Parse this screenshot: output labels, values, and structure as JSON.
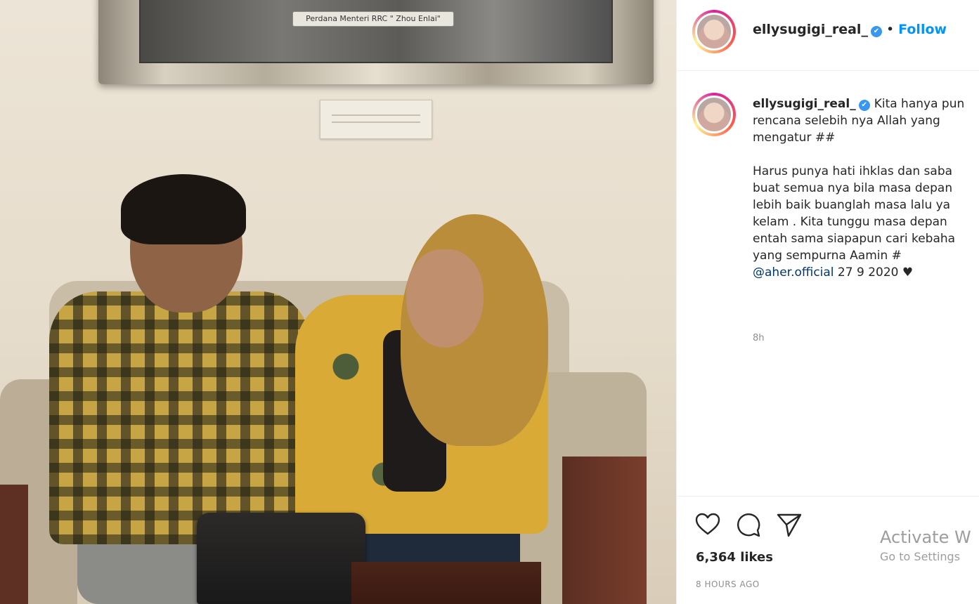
{
  "photo": {
    "frame_caption": "Perdana Menteri RRC \" Zhou Enlai\""
  },
  "header": {
    "username": "ellysugigi_real_",
    "verified_glyph": "✔",
    "separator": "•",
    "follow_label": "Follow"
  },
  "caption": {
    "username": "ellysugigi_real_",
    "verified_glyph": "✔",
    "lines": [
      "Kita hanya pun",
      "rencana selebih nya Allah yang",
      "mengatur ##",
      "Harus punya hati ihklas dan saba",
      "buat semua nya bila masa depan",
      "lebih baik buanglah masa lalu ya",
      "kelam . Kita tunggu masa depan",
      "entah sama siapapun cari kebaha",
      "yang sempurna Aamin #"
    ],
    "mention": "@aher.official",
    "mention_tail": " 27 9 2020 ♥",
    "time_ago": "8h"
  },
  "actions": {
    "icons": [
      "heart-icon",
      "comment-icon",
      "share-icon"
    ],
    "likes": "6,364 likes",
    "posted_ago": "8 HOURS AGO"
  },
  "watermark": {
    "title": "Activate W",
    "subtitle": "Go to Settings"
  },
  "colors": {
    "accent": "#0095f6",
    "verified": "#3897f0",
    "text": "#262626",
    "muted": "#8e8e8e"
  }
}
